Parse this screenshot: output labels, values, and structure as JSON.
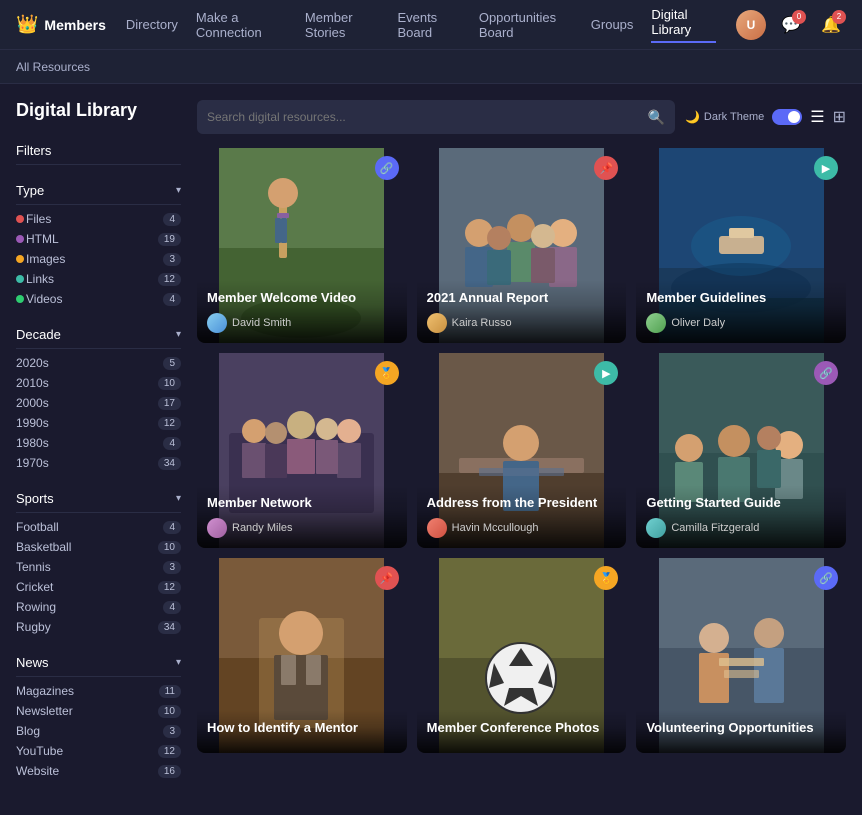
{
  "navbar": {
    "brand": "Members",
    "crown": "👑",
    "links": [
      {
        "label": "Directory",
        "active": false
      },
      {
        "label": "Make a Connection",
        "active": false
      },
      {
        "label": "Member Stories",
        "active": false
      },
      {
        "label": "Events Board",
        "active": false
      },
      {
        "label": "Opportunities Board",
        "active": false
      },
      {
        "label": "Groups",
        "active": false
      },
      {
        "label": "Digital Library",
        "active": true
      }
    ],
    "notification_count_chat": "0",
    "notification_count_bell": "2",
    "avatar_initials": "U"
  },
  "sub_navbar": {
    "link": "All Resources"
  },
  "sidebar": {
    "title": "Digital Library",
    "filters_label": "Filters",
    "sections": [
      {
        "label": "Type",
        "items": [
          {
            "name": "Files",
            "count": "4",
            "dot_class": "filter-dot-red"
          },
          {
            "name": "HTML",
            "count": "19",
            "dot_class": "filter-dot-purple"
          },
          {
            "name": "Images",
            "count": "3",
            "dot_class": "filter-dot-orange"
          },
          {
            "name": "Links",
            "count": "12",
            "dot_class": "filter-dot-teal"
          },
          {
            "name": "Videos",
            "count": "4",
            "dot_class": "filter-dot-green"
          }
        ]
      },
      {
        "label": "Decade",
        "items": [
          {
            "name": "2020s",
            "count": "5"
          },
          {
            "name": "2010s",
            "count": "10"
          },
          {
            "name": "2000s",
            "count": "17"
          },
          {
            "name": "1990s",
            "count": "12"
          },
          {
            "name": "1980s",
            "count": "4"
          },
          {
            "name": "1970s",
            "count": "34"
          }
        ]
      },
      {
        "label": "Sports",
        "items": [
          {
            "name": "Football",
            "count": "4"
          },
          {
            "name": "Basketball",
            "count": "10"
          },
          {
            "name": "Tennis",
            "count": "3"
          },
          {
            "name": "Cricket",
            "count": "12"
          },
          {
            "name": "Rowing",
            "count": "4"
          },
          {
            "name": "Rugby",
            "count": "34"
          }
        ]
      },
      {
        "label": "News",
        "items": [
          {
            "name": "Magazines",
            "count": "11"
          },
          {
            "name": "Newsletter",
            "count": "10"
          },
          {
            "name": "Blog",
            "count": "3"
          },
          {
            "name": "YouTube",
            "count": "12"
          },
          {
            "name": "Website",
            "count": "16"
          }
        ]
      }
    ]
  },
  "search": {
    "placeholder": "Search digital resources..."
  },
  "theme": {
    "label": "Dark Theme"
  },
  "cards": [
    {
      "title": "Member Welcome Video",
      "author": "David Smith",
      "bg_class": "card-bg-1",
      "avatar_class": "av1",
      "badge_class": "badge-blue",
      "badge_icon": "🔗",
      "has_play": false
    },
    {
      "title": "2021 Annual Report",
      "author": "Kaira Russo",
      "bg_class": "card-bg-2",
      "avatar_class": "av2",
      "badge_class": "badge-pink",
      "badge_icon": "📌",
      "has_play": false
    },
    {
      "title": "Member Guidelines",
      "author": "Oliver Daly",
      "bg_class": "card-bg-3",
      "avatar_class": "av3",
      "badge_class": "badge-teal",
      "badge_icon": "▶",
      "has_play": true
    },
    {
      "title": "Member Network",
      "author": "Randy Miles",
      "bg_class": "card-bg-4",
      "avatar_class": "av4",
      "badge_class": "badge-orange",
      "badge_icon": "🏅",
      "has_play": false
    },
    {
      "title": "Address from the President",
      "author": "Havin Mccullough",
      "bg_class": "card-bg-5",
      "avatar_class": "av5",
      "badge_class": "badge-teal",
      "badge_icon": "▶",
      "has_play": true
    },
    {
      "title": "Getting Started Guide",
      "author": "Camilla Fitzgerald",
      "bg_class": "card-bg-6",
      "avatar_class": "av6",
      "badge_class": "badge-purple",
      "badge_icon": "🔗",
      "has_play": false
    },
    {
      "title": "How to Identify a Mentor",
      "author": "",
      "bg_class": "card-bg-7",
      "avatar_class": "av1",
      "badge_class": "badge-pink",
      "badge_icon": "📌",
      "has_play": false
    },
    {
      "title": "Member Conference Photos",
      "author": "",
      "bg_class": "card-bg-8",
      "avatar_class": "av2",
      "badge_class": "badge-orange",
      "badge_icon": "🏅",
      "has_play": false
    },
    {
      "title": "Volunteering Opportunities",
      "author": "",
      "bg_class": "card-bg-9",
      "avatar_class": "av3",
      "badge_class": "badge-blue",
      "badge_icon": "🔗",
      "has_play": false
    }
  ]
}
